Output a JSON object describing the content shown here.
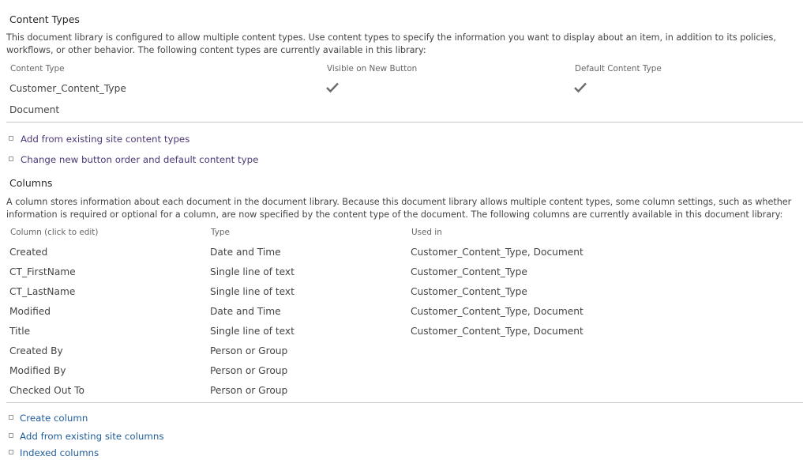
{
  "content_types": {
    "title": "Content Types",
    "description": "This document library is configured to allow multiple content types. Use content types to specify the information you want to display about an item, in addition to its policies, workflows, or other behavior. The following content types are currently available in this library:",
    "headers": [
      "Content Type",
      "Visible on New Button",
      "Default Content Type"
    ],
    "rows": [
      {
        "name": "Customer_Content_Type",
        "visible": "check-icon",
        "default": "check-icon"
      },
      {
        "name": "Document",
        "visible": "",
        "default": ""
      }
    ],
    "links": [
      {
        "label": "Add from existing site content types"
      },
      {
        "label": "Change new button order and default content type"
      }
    ]
  },
  "columns": {
    "title": "Columns",
    "description": "A column stores information about each document in the document library. Because this document library allows multiple content types, some column settings, such as whether information is required or optional for a column, are now specified by the content type of the document. The following columns are currently available in this document library:",
    "headers": [
      "Column (click to edit)",
      "Type",
      "Used in"
    ],
    "rows": [
      {
        "name": "Created",
        "type": "Date and Time",
        "used_in": "Customer_Content_Type, Document"
      },
      {
        "name": "CT_FirstName",
        "type": "Single line of text",
        "used_in": "Customer_Content_Type"
      },
      {
        "name": "CT_LastName",
        "type": "Single line of text",
        "used_in": "Customer_Content_Type"
      },
      {
        "name": "Modified",
        "type": "Date and Time",
        "used_in": "Customer_Content_Type, Document"
      },
      {
        "name": "Title",
        "type": "Single line of text",
        "used_in": "Customer_Content_Type, Document"
      },
      {
        "name": "Created By",
        "type": "Person or Group",
        "used_in": ""
      },
      {
        "name": "Modified By",
        "type": "Person or Group",
        "used_in": ""
      },
      {
        "name": "Checked Out To",
        "type": "Person or Group",
        "used_in": ""
      }
    ],
    "links": [
      {
        "label": "Create column"
      },
      {
        "label": "Add from existing site columns"
      },
      {
        "label": "Indexed columns"
      }
    ]
  },
  "colors": {
    "visited_link": "#4d3a78",
    "link": "#1f5c99",
    "check": "#6b6b6b"
  }
}
